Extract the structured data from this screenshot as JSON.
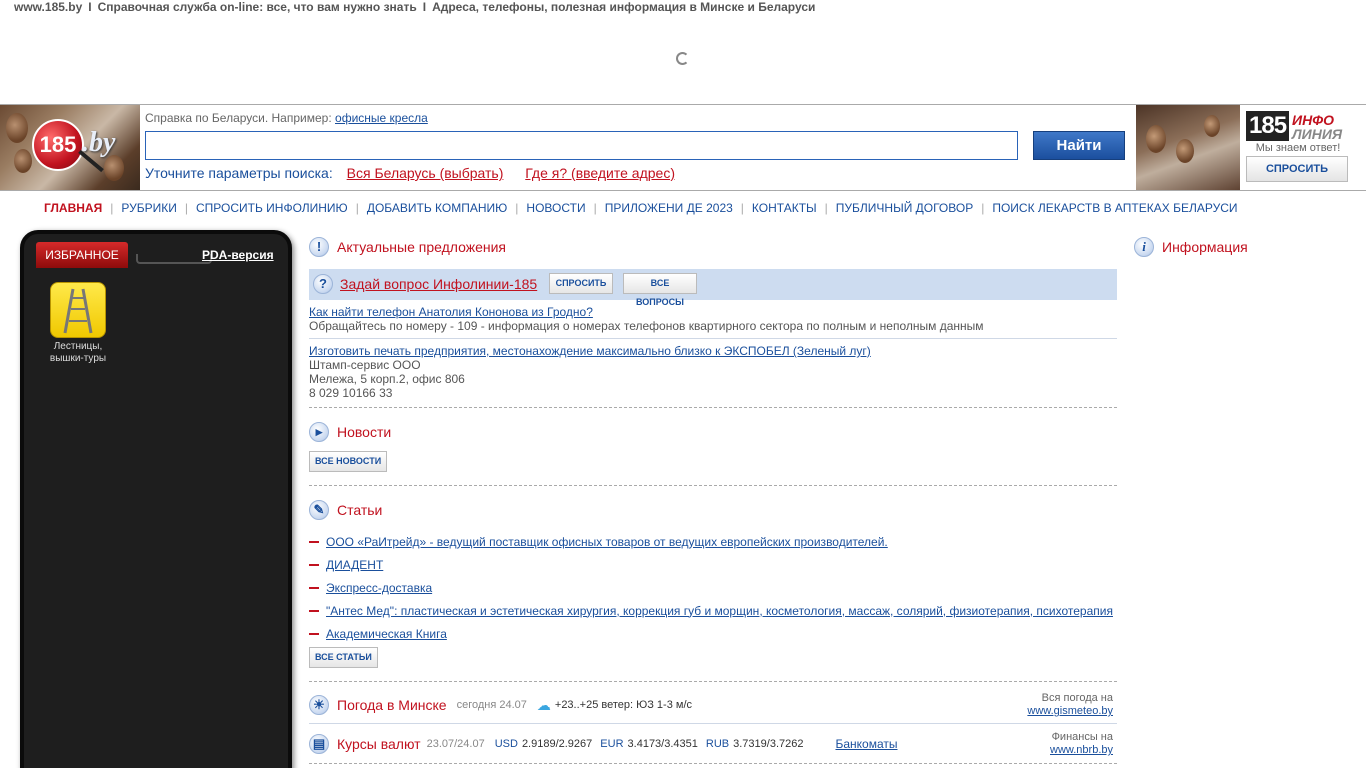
{
  "top_line": {
    "site": "www.185.by",
    "sep": "I",
    "part1": "Справочная служба on-line: все, что вам нужно знать",
    "part2": "Адреса, телефоны, полезная информация в Минске и Беларуси"
  },
  "header": {
    "logo_num": "185",
    "logo_by": ".by",
    "hint_text": "Справка по Беларуси. Например:",
    "hint_link": "офисные кресла",
    "search_value": "",
    "search_button": "Найти",
    "refine_label": "Уточните параметры поиска:",
    "refine_region": "Вся Беларусь (выбрать)",
    "refine_where": "Где я? (введите адрес)",
    "info_num": "185",
    "info_word1": "ИНФО",
    "info_word2": "ЛИНИЯ",
    "info_tagline": "Мы знаем ответ!",
    "ask_button": "СПРОСИТЬ"
  },
  "nav": [
    {
      "label": "ГЛАВНАЯ",
      "active": true
    },
    {
      "label": "РУБРИКИ"
    },
    {
      "label": "СПРОСИТЬ ИНФОЛИНИЮ"
    },
    {
      "label": "ДОБАВИТЬ КОМПАНИЮ"
    },
    {
      "label": "НОВОСТИ"
    },
    {
      "label": "ПРИЛОЖЕНИ ДЕ 2023"
    },
    {
      "label": "КОНТАКТЫ"
    },
    {
      "label": "ПУБЛИЧНЫЙ ДОГОВОР"
    },
    {
      "label": "ПОИСК ЛЕКАРСТВ В АПТЕКАХ БЕЛАРУСИ"
    }
  ],
  "left_panel": {
    "favorites_tab": "ИЗБРАННОЕ",
    "pda_link": "PDA-версия",
    "fav_item_line1": "Лестницы,",
    "fav_item_line2": "вышки-туры"
  },
  "offers": {
    "title": "Актуальные предложения",
    "icon": "exclamation-icon"
  },
  "ask": {
    "title": "Задай вопрос Инфолинии-185",
    "btn_ask": "СПРОСИТЬ",
    "btn_all": "ВСЕ ВОПРОСЫ"
  },
  "qa": [
    {
      "question": "Как найти телефон Анатолия Кононова из Гродно?",
      "answer": "Обращайтесь по номеру - 109 - информация о номерах телефонов квартирного сектора по полным и неполным данным"
    },
    {
      "question": "Изготовить печать предприятия, местонахождение максимально близко к ЭКСПОБЕЛ (Зеленый луг)",
      "line1": "Штамп-сервис ООО",
      "line2": "Мележа, 5 корп.2, офис 806",
      "line3": "8 029 10166 33"
    }
  ],
  "news": {
    "title": "Новости",
    "button": "ВСЕ НОВОСТИ"
  },
  "articles": {
    "title": "Статьи",
    "button": "ВСЕ СТАТЬИ",
    "items": [
      "ООО «РаИтрейд» - ведущий поставщик офисных товаров от ведущих европейских производителей.",
      "ДИАДЕНТ",
      "Экспресс-доставка",
      "\"Антес Мед\": пластическая и эстетическая хирургия, коррекция губ и морщин, косметология, массаж, солярий, физиотерапия, психотерапия",
      "Академическая Книга"
    ]
  },
  "weather": {
    "title": "Погода в Минске",
    "date": "сегодня 24.07",
    "forecast": "+23..+25 ветер: ЮЗ 1-3 м/с",
    "src_label": "Вся погода на",
    "src_link": "www.gismeteo.by"
  },
  "rates": {
    "title": "Курсы валют",
    "date": "23.07/24.07",
    "usd_label": "USD",
    "usd": "2.9189/2.9267",
    "eur_label": "EUR",
    "eur": "3.4173/3.4351",
    "rub_label": "RUB",
    "rub": "3.7319/3.7262",
    "atm_link": "Банкоматы",
    "src_label": "Финансы на",
    "src_link": "www.nbrb.by"
  },
  "info": {
    "title": "Информация"
  },
  "colors": {
    "accent_red": "#c1121f",
    "link_blue": "#1a4f9c",
    "ask_bar_bg": "#cddcf0",
    "panel_bg": "#1e1e1e"
  }
}
